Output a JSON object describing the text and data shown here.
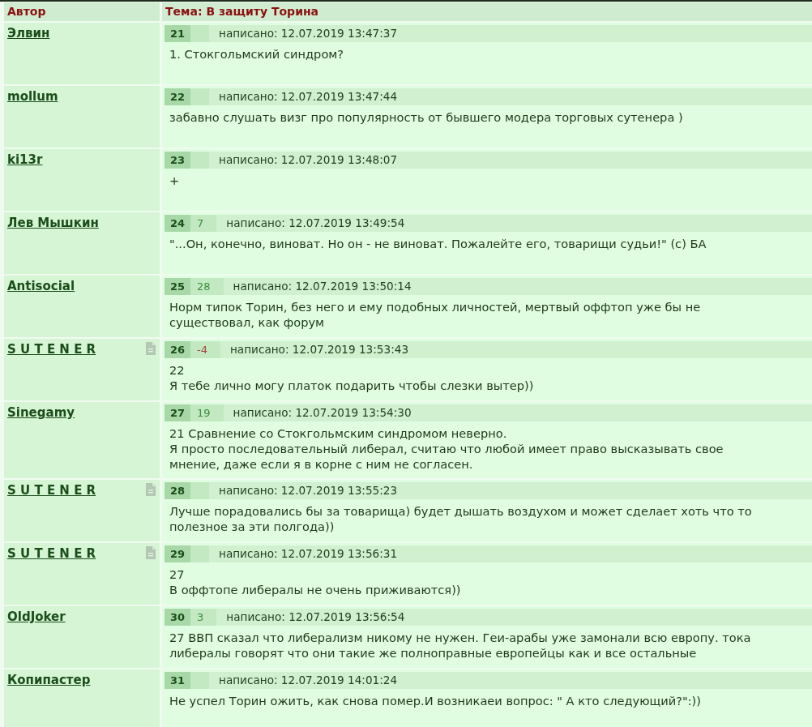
{
  "table": {
    "columns": [
      {
        "label": "Автор"
      },
      {
        "label": "Тема: В защиту Торина"
      }
    ]
  },
  "posts": [
    {
      "author": "Элвин",
      "note_icon": false,
      "number": "21",
      "posted": "написано: 12.07.2019 13:47:37",
      "text": "1. Стокгольмский синдром?"
    },
    {
      "author": "mollum",
      "note_icon": false,
      "number": "22",
      "posted": "написано: 12.07.2019 13:47:44",
      "text": "забавно слушать визг про популярность от бывшего модера торговых сутенера )"
    },
    {
      "author": "ki13r",
      "note_icon": false,
      "number": "23",
      "posted": "написано: 12.07.2019 13:48:07",
      "text": "+"
    },
    {
      "author": "Лев Мышкин",
      "note_icon": false,
      "number": "24",
      "rating": {
        "text": "7",
        "color": "#3c8c3c"
      },
      "posted": "написано: 12.07.2019 13:49:54",
      "text": "\"...Он, конечно, виноват. Но он - не виноват. Пожалейте его, товарищи судьи!\" (с) БА"
    },
    {
      "author": "Antisocial",
      "note_icon": false,
      "number": "25",
      "rating": {
        "text": "28",
        "color": "#3c8c3c"
      },
      "posted": "написано: 12.07.2019 13:50:14",
      "text": "Норм типок Торин, без него и ему подобных личностей, мертвый оффтоп уже бы не существовал, как форум"
    },
    {
      "author": "S U T E N E R",
      "note_icon": true,
      "number": "26",
      "rating": {
        "text": "-4",
        "color": "#a84040"
      },
      "posted": "написано: 12.07.2019 13:53:43",
      "text": "22\nЯ тебе лично могу платок подарить чтобы слезки вытер))"
    },
    {
      "author": "Sinegamy",
      "note_icon": false,
      "number": "27",
      "rating": {
        "text": "19",
        "color": "#3c8c3c"
      },
      "posted": "написано: 12.07.2019 13:54:30",
      "text": "21 Сравнение со Стокгольмским синдромом неверно.\nЯ просто последовательный либерал, считаю что любой имеет право высказывать свое мнение, даже если я в корне с ним не согласен."
    },
    {
      "author": "S U T E N E R",
      "note_icon": true,
      "number": "28",
      "posted": "написано: 12.07.2019 13:55:23",
      "text": "Лучше порадовались бы за товарища) будет дышать воздухом и может сделает хоть что то полезное за эти полгода))"
    },
    {
      "author": "S U T E N E R",
      "note_icon": true,
      "number": "29",
      "posted": "написано: 12.07.2019 13:56:31",
      "text": "27\nВ оффтопе либералы не очень приживаются))"
    },
    {
      "author": "OldJoker",
      "note_icon": false,
      "number": "30",
      "rating": {
        "text": "3",
        "color": "#3c8c3c"
      },
      "posted": "написано: 12.07.2019 13:56:54",
      "text": "27 ВВП сказал что либерализм никому не нужен. Геи-арабы уже замонали всю европу. тока либералы говорят что они такие же полноправные европейцы как и все остальные"
    },
    {
      "author": "Копипастер",
      "note_icon": false,
      "number": "31",
      "posted": "написано: 12.07.2019 14:01:24",
      "text": "Не успел Торин ожить, как снова помер.И возникаеи вопрос: \" А кто следующий?\":))"
    }
  ]
}
